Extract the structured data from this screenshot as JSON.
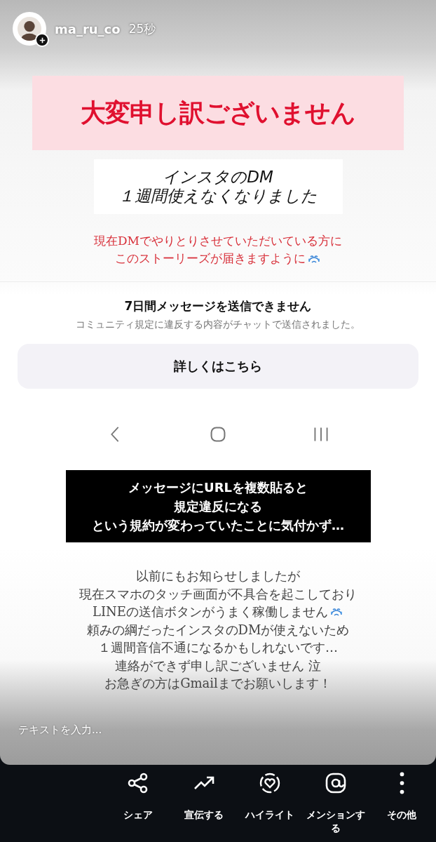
{
  "story": {
    "username": "ma_ru_co",
    "time": "25秒"
  },
  "banner": "大変申し訳ございません",
  "headline_lines": [
    "インスタのDM",
    "１週間使えなくなりました"
  ],
  "notice_lines": [
    {
      "text": "現在DMでやりとりさせていただいている方に",
      "emoji": false
    },
    {
      "text": "このストーリーズが届きますように",
      "emoji": true
    }
  ],
  "embedded_screenshot": {
    "title": "7日間メッセージを送信できません",
    "body": "コミュニティ規定に違反する内容がチャットで送信されました。",
    "button": "詳しくはこちら"
  },
  "caption_lines": [
    "メッセージにURLを複数貼ると",
    "規定違反になる",
    "という規約が変わっていたことに気付かず…"
  ],
  "body_lines": [
    {
      "text": "以前にもお知らせしましたが",
      "emoji": false
    },
    {
      "text": "現在スマホのタッチ画面が不具合を起こしており",
      "emoji": false
    },
    {
      "text": "LINEの送信ボタンがうまく稼働しません",
      "emoji": true
    },
    {
      "text": "頼みの綱だったインスタのDMが使えないため",
      "emoji": false
    },
    {
      "text": "１週間音信不通になるかもしれないです…",
      "emoji": false
    },
    {
      "text": "連絡ができず申し訳ございません 泣",
      "emoji": false
    },
    {
      "text": "お急ぎの方はGmailまでお願いします！",
      "emoji": false
    }
  ],
  "reply_field": {
    "placeholder": "テキストを入力..."
  },
  "actions": [
    {
      "kind": "share",
      "label": "シェア"
    },
    {
      "kind": "promote",
      "label": "宣伝する"
    },
    {
      "kind": "highlight",
      "label": "ハイライト"
    },
    {
      "kind": "mention",
      "label": "メンションする"
    },
    {
      "kind": "more",
      "label": "その他"
    }
  ]
}
